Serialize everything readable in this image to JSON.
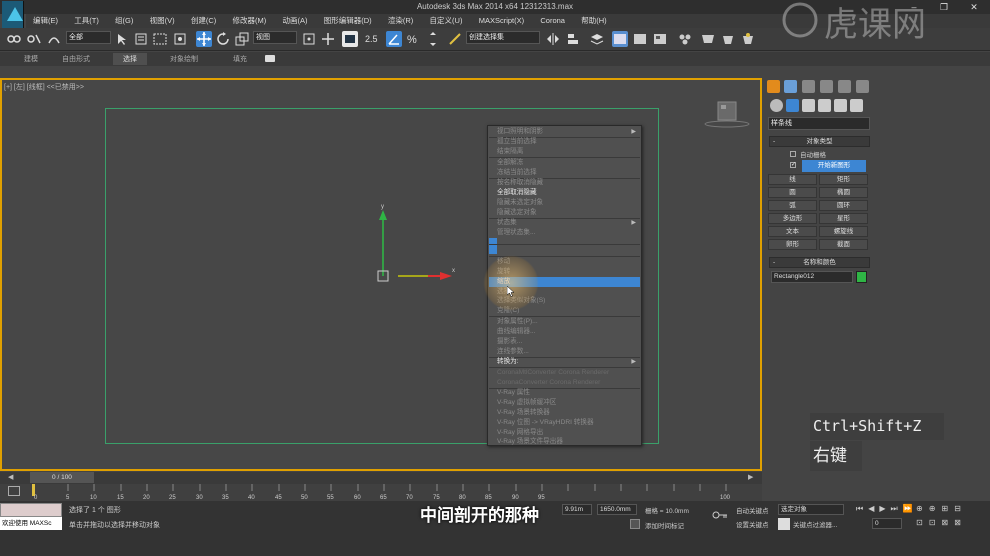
{
  "window": {
    "title": "Autodesk 3ds Max  2014 x64      12312313.max",
    "minimize": "–",
    "maximize": "❐",
    "close": "✕"
  },
  "menubar": {
    "items": [
      "编辑(E)",
      "工具(T)",
      "组(G)",
      "视图(V)",
      "创建(C)",
      "修改器(M)",
      "动画(A)",
      "图形编辑器(D)",
      "渲染(R)",
      "自定义(U)",
      "MAXScript(X)",
      "Corona",
      "帮助(H)"
    ]
  },
  "toolbar": {
    "selection_filter": "全部",
    "ref_coord": "视图",
    "named_selection": "创建选择集"
  },
  "ribbon": {
    "tabs": [
      "建模",
      "自由形式",
      "选择",
      "对象绘制",
      "填充"
    ]
  },
  "viewport": {
    "label": "[+] [左] [线框] <<已禁用>>",
    "axis_x": "x",
    "axis_y": "y"
  },
  "context_menu": {
    "items": [
      {
        "label": "视口照明和阴影",
        "style": "dim",
        "arrow": true
      },
      {
        "label": "孤立当前选择",
        "style": "dim"
      },
      {
        "label": "结束隔离",
        "style": "dim"
      },
      {
        "label": "全部解冻",
        "style": "dim"
      },
      {
        "label": "冻结当前选择",
        "style": "dim"
      },
      {
        "label": "按名称取消隐藏",
        "style": "dim"
      },
      {
        "label": "全部取消隐藏",
        "style": "white"
      },
      {
        "label": "隐藏未选定对象",
        "style": "dim"
      },
      {
        "label": "隐藏选定对象",
        "style": "dim"
      },
      {
        "label": "状态集",
        "style": "dim",
        "arrow": true
      },
      {
        "label": "管理状态集...",
        "style": "dim"
      },
      {
        "label": "移动",
        "style": "dim"
      },
      {
        "label": "旋转",
        "style": "dim"
      },
      {
        "label": "缩放",
        "style": "highlight"
      },
      {
        "label": "选择",
        "style": "dim"
      },
      {
        "label": "选择类似对象(S)",
        "style": "dim"
      },
      {
        "label": "克隆(C)",
        "style": "dim"
      },
      {
        "label": "对象属性(P)...",
        "style": "dim"
      },
      {
        "label": "曲线编辑器...",
        "style": "dim"
      },
      {
        "label": "摄影表...",
        "style": "dim"
      },
      {
        "label": "连线参数...",
        "style": "dim"
      },
      {
        "label": "转换为:",
        "style": "white",
        "arrow": true
      },
      {
        "label": "CoronaMtlConverter Corona Renderer",
        "style": "dim"
      },
      {
        "label": "CoronaConverter Corona Renderer",
        "style": "dim"
      },
      {
        "label": "V-Ray 属性",
        "style": "dim"
      },
      {
        "label": "V-Ray 虚拟帧缓冲区",
        "style": "dim"
      },
      {
        "label": "V-Ray 场景转换器",
        "style": "dim"
      },
      {
        "label": "V-Ray 位图 -> VRayHDRI 转换器",
        "style": "dim"
      },
      {
        "label": "V-Ray 网格导出",
        "style": "dim"
      },
      {
        "label": "V-Ray 场景文件导出器",
        "style": "dim"
      }
    ]
  },
  "command_panel": {
    "category": "样条线",
    "object_type_title": "对象类型",
    "auto_grid": "自动栅格",
    "start_new_shape": "开始新图形",
    "buttons": [
      "线",
      "矩形",
      "圆",
      "椭圆",
      "弧",
      "圆环",
      "多边形",
      "星形",
      "文本",
      "螺旋线",
      "卵形",
      "截面"
    ],
    "name_color_title": "名称和颜色",
    "object_name": "Rectangle012",
    "object_color": "#2fb545"
  },
  "timeline": {
    "frame": "0 / 100",
    "ticks": [
      "0",
      "5",
      "10",
      "15",
      "20",
      "25",
      "30",
      "35",
      "40",
      "45",
      "50",
      "55",
      "60",
      "65",
      "70",
      "75",
      "80",
      "85",
      "90",
      "95",
      "100"
    ]
  },
  "status": {
    "welcome": "欢迎使用 MAXSc",
    "selected": "选择了 1 个 图形",
    "prompt": "单击并拖动以选择并移动对象",
    "coord_x": "9.91m",
    "coord_z": "1650.0mm",
    "grid": "栅格 = 10.0mm",
    "add_time_tag": "添加时间标记",
    "auto_key": "自动关键点",
    "set_key": "设置关键点",
    "selected_object": "选定对象",
    "key_filters": "关键点过滤器...",
    "frame_field": "0"
  },
  "captions": {
    "main": "中间剖开的那种",
    "shortcut": "Ctrl+Shift+Z",
    "right_click": "右键"
  },
  "watermark": {
    "text": "虎课网"
  }
}
